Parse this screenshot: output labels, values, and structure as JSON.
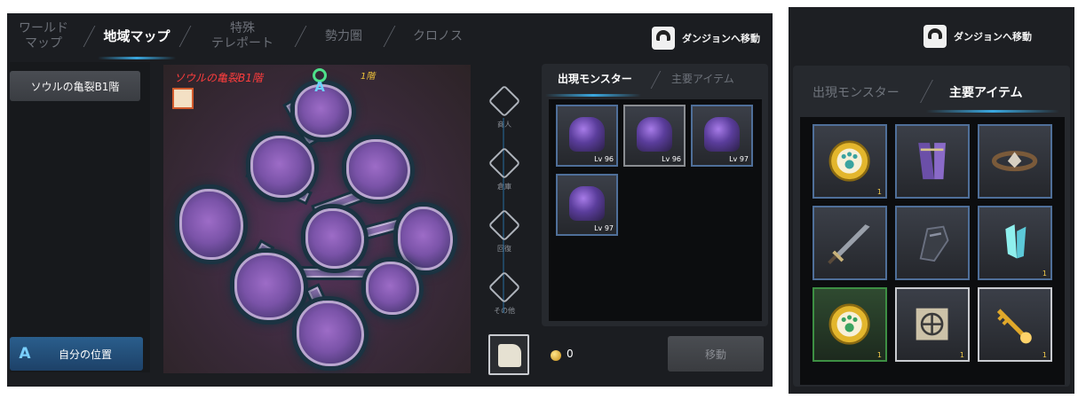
{
  "top_tabs": [
    {
      "label": "ワールド\nマップ",
      "active": false
    },
    {
      "label": "地域マップ",
      "active": true
    },
    {
      "label": "特殊\nテレポート",
      "active": false
    },
    {
      "label": "勢力圏",
      "active": false
    },
    {
      "label": "クロノス",
      "active": false
    }
  ],
  "dungeon_button": {
    "label": "ダンジョンへ移動"
  },
  "dungeon_list": {
    "items": [
      "ソウルの亀裂B1階"
    ]
  },
  "my_position": {
    "label": "自分の位置"
  },
  "map": {
    "title": "ソウルの亀裂B1階",
    "floor": "1階"
  },
  "filters": [
    "商人",
    "倉庫",
    "回復",
    "その他"
  ],
  "monster_panel": {
    "tabs": [
      {
        "label": "出現モンスター",
        "active": true
      },
      {
        "label": "主要アイテム",
        "active": false
      }
    ],
    "monsters": [
      {
        "level": "Lv 96",
        "icon": "spider-monster"
      },
      {
        "level": "Lv 96",
        "icon": "mantis-monster"
      },
      {
        "level": "Lv 97",
        "icon": "golem-monster"
      },
      {
        "level": "Lv 97",
        "icon": "beast-monster"
      }
    ]
  },
  "footer": {
    "coin_value": "0",
    "move_label": "移動"
  },
  "right_panel": {
    "dungeon_button": "ダンジョンへ移動",
    "tabs": [
      {
        "label": "出現モンスター",
        "active": false
      },
      {
        "label": "主要アイテム",
        "active": true
      }
    ],
    "items": [
      {
        "icon": "paw-coin-icon",
        "quantity": "1",
        "frame": "blue"
      },
      {
        "icon": "leg-armor-icon",
        "quantity": "",
        "frame": "blue"
      },
      {
        "icon": "belt-icon",
        "quantity": "",
        "frame": "blue"
      },
      {
        "icon": "sword-icon",
        "quantity": "",
        "frame": "blue"
      },
      {
        "icon": "gauntlet-icon",
        "quantity": "",
        "frame": "blue"
      },
      {
        "icon": "crystal-shard-icon",
        "quantity": "1",
        "frame": "blue"
      },
      {
        "icon": "paw-coin-icon",
        "quantity": "1",
        "frame": "green"
      },
      {
        "icon": "scroll-emblem-icon",
        "quantity": "1",
        "frame": "white"
      },
      {
        "icon": "golden-key-icon",
        "quantity": "1",
        "frame": "white"
      }
    ]
  },
  "colors": {
    "accent": "#3aa8e0",
    "map_title": "#ff3d3d",
    "floor_label": "#f0c53a",
    "rare_frame": "#4f6f99",
    "uncommon_frame": "#3d8f43"
  }
}
